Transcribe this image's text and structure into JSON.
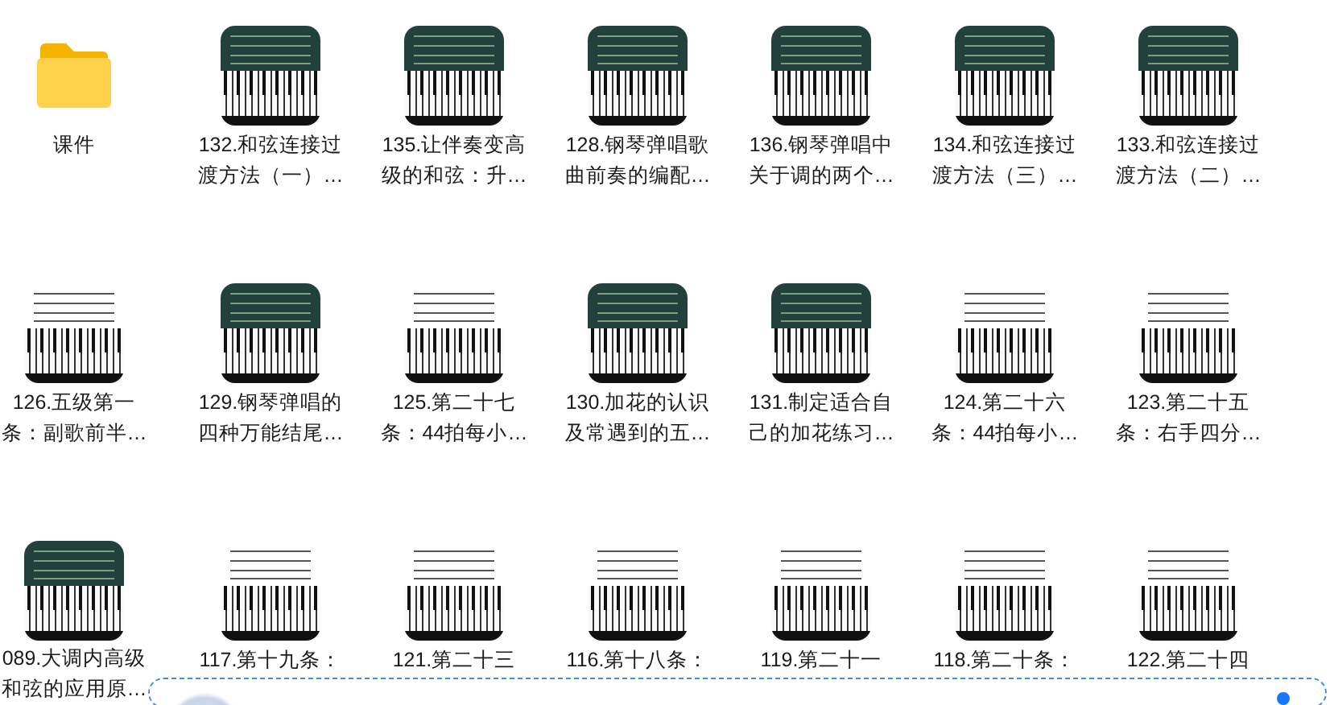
{
  "files": [
    {
      "kind": "folder",
      "lines": [
        "课件"
      ]
    },
    {
      "kind": "video",
      "dark_board": true,
      "lines": [
        "132.和弦连接过",
        "渡方法（一）…"
      ]
    },
    {
      "kind": "video",
      "dark_board": true,
      "lines": [
        "135.让伴奏变高",
        "级的和弦：升…"
      ]
    },
    {
      "kind": "video",
      "dark_board": true,
      "lines": [
        "128.钢琴弹唱歌",
        "曲前奏的编配…"
      ]
    },
    {
      "kind": "video",
      "dark_board": true,
      "lines": [
        "136.钢琴弹唱中",
        "关于调的两个…"
      ]
    },
    {
      "kind": "video",
      "dark_board": true,
      "lines": [
        "134.和弦连接过",
        "渡方法（三）…"
      ]
    },
    {
      "kind": "video",
      "dark_board": true,
      "lines": [
        "133.和弦连接过",
        "渡方法（二）…"
      ]
    },
    {
      "kind": "video",
      "dark_board": false,
      "lines": [
        "126.五级第一",
        "条：副歌前半…"
      ]
    },
    {
      "kind": "video",
      "dark_board": true,
      "lines": [
        "129.钢琴弹唱的",
        "四种万能结尾…"
      ]
    },
    {
      "kind": "video",
      "dark_board": false,
      "lines": [
        "125.第二十七",
        "条：44拍每小…"
      ]
    },
    {
      "kind": "video",
      "dark_board": true,
      "lines": [
        "130.加花的认识",
        "及常遇到的五…"
      ]
    },
    {
      "kind": "video",
      "dark_board": true,
      "lines": [
        "131.制定适合自",
        "己的加花练习…"
      ]
    },
    {
      "kind": "video",
      "dark_board": false,
      "lines": [
        "124.第二十六",
        "条：44拍每小…"
      ]
    },
    {
      "kind": "video",
      "dark_board": false,
      "lines": [
        "123.第二十五",
        "条：右手四分…"
      ]
    },
    {
      "kind": "video",
      "dark_board": true,
      "lines": [
        "089.大调内高级",
        "和弦的应用原…"
      ]
    },
    {
      "kind": "video",
      "dark_board": false,
      "lines": [
        "117.第十九条："
      ]
    },
    {
      "kind": "video",
      "dark_board": false,
      "lines": [
        "121.第二十三"
      ]
    },
    {
      "kind": "video",
      "dark_board": false,
      "lines": [
        "116.第十八条："
      ]
    },
    {
      "kind": "video",
      "dark_board": false,
      "lines": [
        "119.第二十一"
      ]
    },
    {
      "kind": "video",
      "dark_board": false,
      "lines": [
        "118.第二十条："
      ]
    },
    {
      "kind": "video",
      "dark_board": false,
      "lines": [
        "122.第二十四"
      ]
    }
  ],
  "popup": {
    "visible": true
  }
}
